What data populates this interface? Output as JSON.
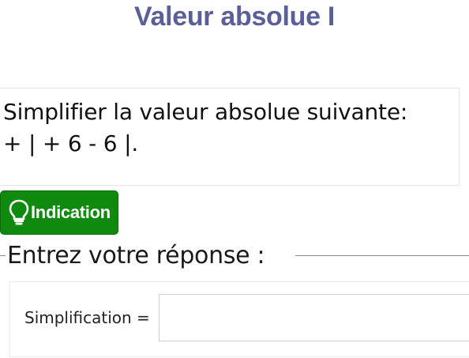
{
  "page": {
    "title": "Valeur absolue I"
  },
  "question": {
    "line1": "Simplifier la valeur absolue suivante:",
    "line2": "+ | + 6 - 6 |."
  },
  "hint_button": {
    "label": "Indication",
    "icon": "lightbulb-icon",
    "color": "#0f8a0f"
  },
  "answer": {
    "legend": "Entrez votre réponse :",
    "label": "Simplification =",
    "value": "",
    "placeholder": ""
  },
  "colors": {
    "title": "#5a5f9a",
    "button": "#0f8a0f"
  }
}
